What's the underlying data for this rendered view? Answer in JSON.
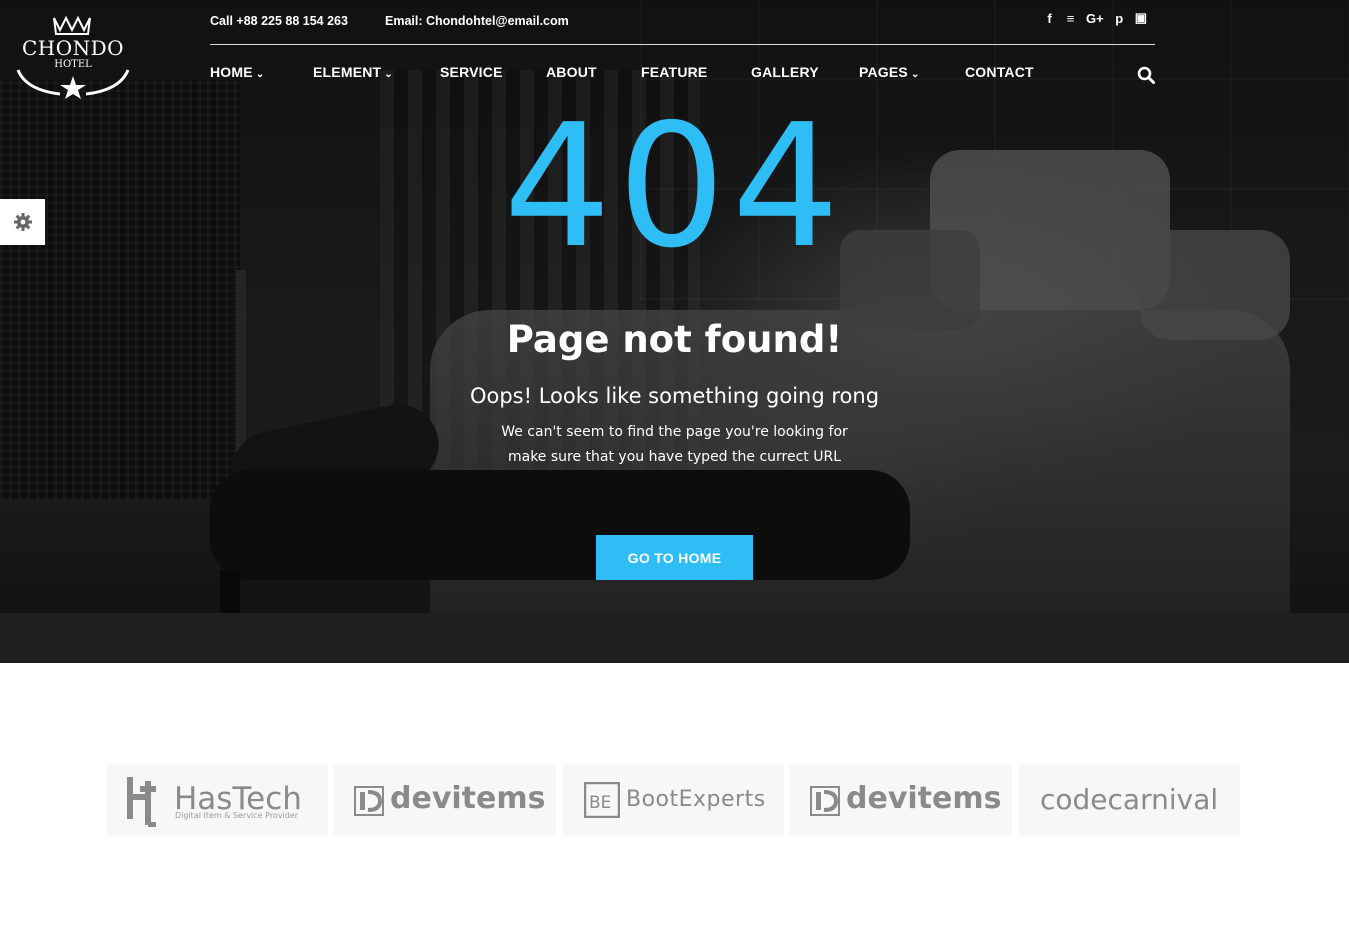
{
  "brand": {
    "name": "CHONDO",
    "sub": "HOTEL"
  },
  "topbar": {
    "phone": "Call +88 225 88 154 263",
    "email": "Email: Chondohtel@email.com"
  },
  "social": [
    "facebook-icon",
    "rss-icon",
    "google-plus-icon",
    "pinterest-icon",
    "instagram-icon"
  ],
  "social_glyphs": {
    "facebook": "f",
    "rss": "≡",
    "google_plus": "G+",
    "pinterest": "p",
    "instagram": "▣"
  },
  "nav": {
    "items": [
      {
        "label": "HOME",
        "dropdown": true
      },
      {
        "label": "ELEMENT",
        "dropdown": true
      },
      {
        "label": "SERVICE",
        "dropdown": false
      },
      {
        "label": "ABOUT",
        "dropdown": false
      },
      {
        "label": "FEATURE",
        "dropdown": false
      },
      {
        "label": "GALLERY",
        "dropdown": false
      },
      {
        "label": "PAGES",
        "dropdown": true
      },
      {
        "label": "CONTACT",
        "dropdown": false
      }
    ]
  },
  "error": {
    "code": "404",
    "title": "Page not found!",
    "subtitle": "Oops! Looks like something going rong",
    "line1": "We can't seem to find the page you're looking for",
    "line2": "make sure that you have typed the currect URL",
    "button": "GO TO HOME"
  },
  "partners": [
    {
      "name": "HasTech",
      "tagline": "Digital Item & Service Provider"
    },
    {
      "name": "devitems"
    },
    {
      "name": "BootExperts"
    },
    {
      "name": "devitems"
    },
    {
      "name": "codecarnival"
    }
  ],
  "colors": {
    "accent": "#2fbdf5",
    "text_on_dark": "#ffffff",
    "partner_gray": "#8a8a8a"
  }
}
